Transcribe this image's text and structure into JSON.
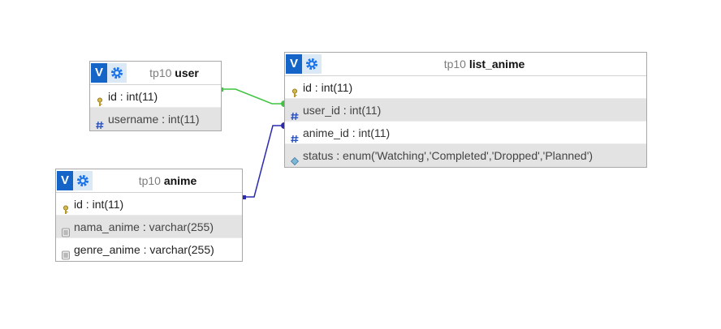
{
  "tables": {
    "user": {
      "db": "tp10",
      "name": "user",
      "columns": [
        {
          "name": "id",
          "sep": " : ",
          "type": "int(11)",
          "icon": "primary-key-icon"
        },
        {
          "name": "username",
          "sep": " : ",
          "type": "int(11)",
          "icon": "numeric-hash-icon"
        }
      ]
    },
    "list_anime": {
      "db": "tp10",
      "name": "list_anime",
      "columns": [
        {
          "name": "id",
          "sep": " : ",
          "type": "int(11)",
          "icon": "primary-key-icon"
        },
        {
          "name": "user_id",
          "sep": " : ",
          "type": "int(11)",
          "icon": "numeric-hash-icon"
        },
        {
          "name": "anime_id",
          "sep": " : ",
          "type": "int(11)",
          "icon": "numeric-hash-icon"
        },
        {
          "name": "status",
          "sep": " : ",
          "type": "enum('Watching','Completed','Dropped','Planned')",
          "icon": "enum-diamond-icon"
        }
      ]
    },
    "anime": {
      "db": "tp10",
      "name": "anime",
      "columns": [
        {
          "name": "id",
          "sep": " : ",
          "type": "int(11)",
          "icon": "primary-key-icon"
        },
        {
          "name": "nama_anime",
          "sep": " : ",
          "type": "varchar(255)",
          "icon": "text-column-icon"
        },
        {
          "name": "genre_anime",
          "sep": " : ",
          "type": "varchar(255)",
          "icon": "text-column-icon"
        }
      ]
    }
  },
  "header_button": {
    "v_label": "V",
    "options_icon": "gear-icon"
  },
  "relations": [
    {
      "from": "user.id",
      "to": "list_anime.user_id",
      "color": "#3ec43e"
    },
    {
      "from": "anime.id",
      "to": "list_anime.anime_id",
      "color": "#2b2bb0"
    }
  ]
}
